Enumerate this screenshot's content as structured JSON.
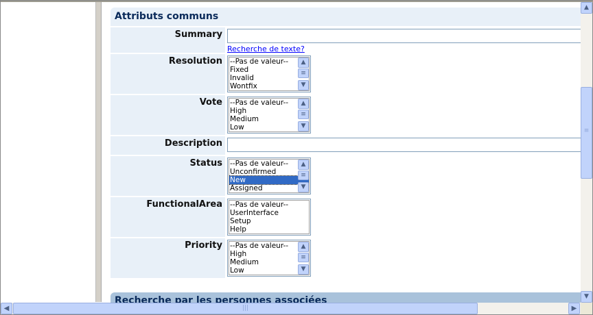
{
  "section_title": "Attributs communs",
  "section2_title": "Recherche par les personnes associées",
  "fields": [
    {
      "label": "Summary",
      "type": "text",
      "value": "",
      "link": "Recherche de texte?"
    },
    {
      "label": "Resolution",
      "type": "list",
      "options": [
        "--Pas de valeur--",
        "Fixed",
        "Invalid",
        "Wontfix"
      ],
      "scroll": true
    },
    {
      "label": "Vote",
      "type": "list",
      "options": [
        "--Pas de valeur--",
        "High",
        "Medium",
        "Low"
      ],
      "scroll": true
    },
    {
      "label": "Description",
      "type": "text",
      "value": ""
    },
    {
      "label": "Status",
      "type": "list",
      "options": [
        "--Pas de valeur--",
        "Unconfirmed",
        "New",
        "Assigned"
      ],
      "selected": "New",
      "scroll": true
    },
    {
      "label": "FunctionalArea",
      "type": "list",
      "options": [
        "--Pas de valeur--",
        "UserInterface",
        "Setup",
        "Help"
      ],
      "scroll": false
    },
    {
      "label": "Priority",
      "type": "list",
      "options": [
        "--Pas de valeur--",
        "High",
        "Medium",
        "Low"
      ],
      "scroll": true
    }
  ]
}
